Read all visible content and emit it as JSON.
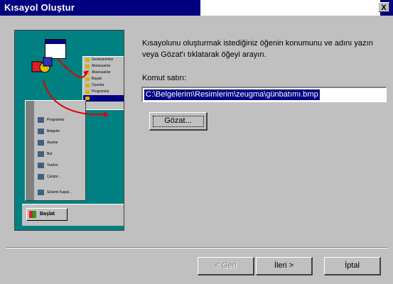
{
  "window": {
    "title": "Kısayol Oluştur",
    "close_label": "X"
  },
  "illustration": {
    "submenu_items": [
      "Gereksinimler",
      "Aksesuarlar",
      "Aksesuarlar",
      "Başlat",
      "Oyunlar",
      "Programlar",
      ""
    ],
    "start_menu_items": [
      "Programlar",
      "Belgeler",
      "Ayarlar",
      "Bul",
      "Yardım",
      "Çalıştır...",
      "Sistemi Kapat..."
    ],
    "start_button": "Başlat"
  },
  "description": "Kısayolunu oluşturmak istediğiniz öğenin konumunu ve adını yazın veya Gözat'ı tıklatarak öğeyi arayın.",
  "command_line": {
    "label": "Komut satırı:",
    "value": "C:\\Belgelerim\\Resimlerim\\zeugma\\günbatımı.bmp"
  },
  "buttons": {
    "browse": "Gözat...",
    "back": "< Geri",
    "next": "İleri >",
    "cancel": "İptal"
  },
  "colors": {
    "titlebar": "#000080",
    "dialog_bg": "#c0c0c0",
    "illustration_bg": "#008080",
    "selection": "#000080"
  }
}
